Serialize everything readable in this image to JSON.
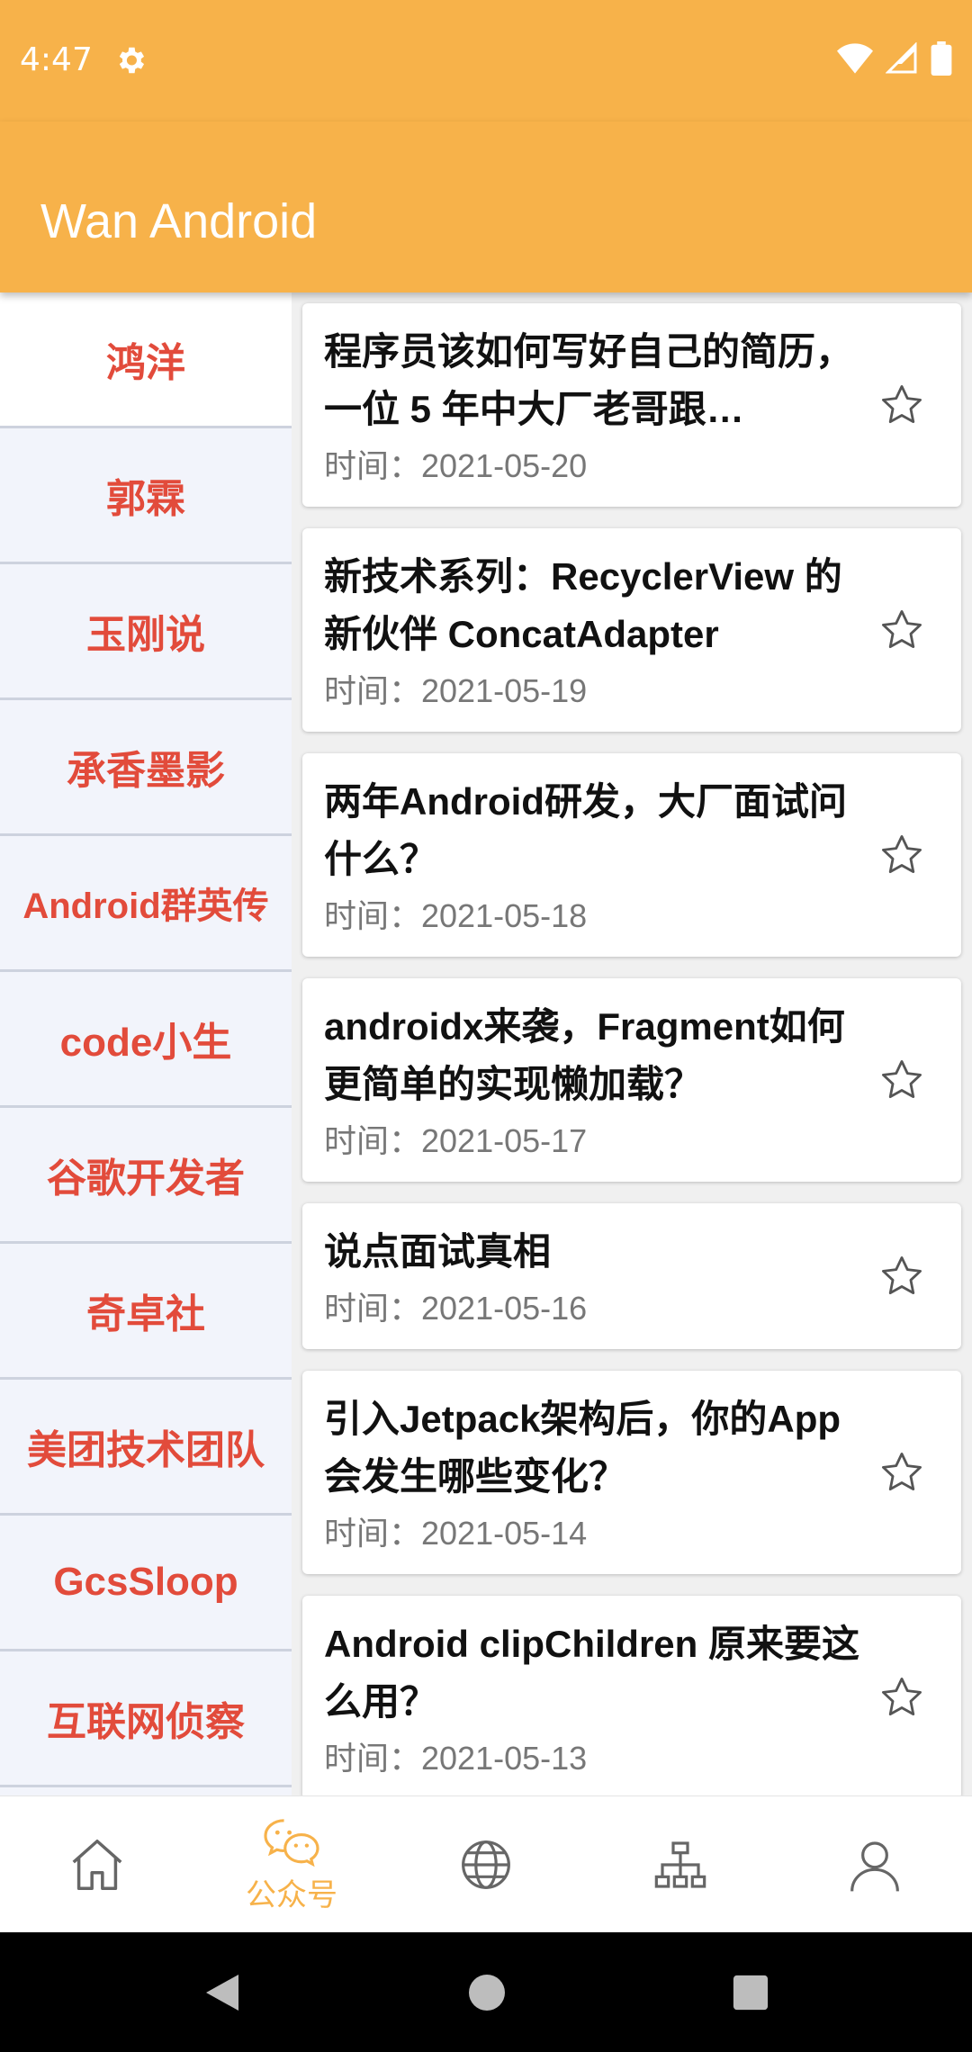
{
  "status_bar": {
    "time": "4:47",
    "icons": [
      "settings-icon",
      "wifi-icon",
      "signal-icon",
      "battery-icon"
    ]
  },
  "toolbar": {
    "title": "Wan Android"
  },
  "sidebar": {
    "items": [
      {
        "label": "鸿洋"
      },
      {
        "label": "郭霖"
      },
      {
        "label": "玉刚说"
      },
      {
        "label": "承香墨影"
      },
      {
        "label": "Android群英传"
      },
      {
        "label": "code小生"
      },
      {
        "label": "谷歌开发者"
      },
      {
        "label": "奇卓社"
      },
      {
        "label": "美团技术团队"
      },
      {
        "label": "GcsSloop"
      },
      {
        "label": "互联网侦察"
      }
    ],
    "active_index": 0
  },
  "articles": [
    {
      "title": "程序员该如何写好自己的简历，一位 5 年中大厂老哥跟…",
      "date": "时间：2021-05-20"
    },
    {
      "title": "新技术系列：RecyclerView 的新伙伴 ConcatAdapter",
      "date": "时间：2021-05-19"
    },
    {
      "title": "两年Android研发，大厂面试问什么？",
      "date": "时间：2021-05-18"
    },
    {
      "title": "androidx来袭，Fragment如何更简单的实现懒加载？",
      "date": "时间：2021-05-17"
    },
    {
      "title": "说点面试真相",
      "date": "时间：2021-05-16"
    },
    {
      "title": "引入Jetpack架构后，你的App会发生哪些变化？",
      "date": "时间：2021-05-14"
    },
    {
      "title": "Android clipChildren 原来要这么用？",
      "date": "时间：2021-05-13"
    }
  ],
  "bottom_nav": {
    "items": [
      {
        "icon": "home-icon",
        "label": ""
      },
      {
        "icon": "wechat-icon",
        "label": "公众号"
      },
      {
        "icon": "globe-icon",
        "label": ""
      },
      {
        "icon": "tree-icon",
        "label": ""
      },
      {
        "icon": "person-icon",
        "label": ""
      }
    ],
    "active_color": "#F7B24A",
    "inactive_color": "#666666"
  },
  "colors": {
    "primary": "#F7B24A",
    "sidebar_text": "#E24B3B"
  }
}
